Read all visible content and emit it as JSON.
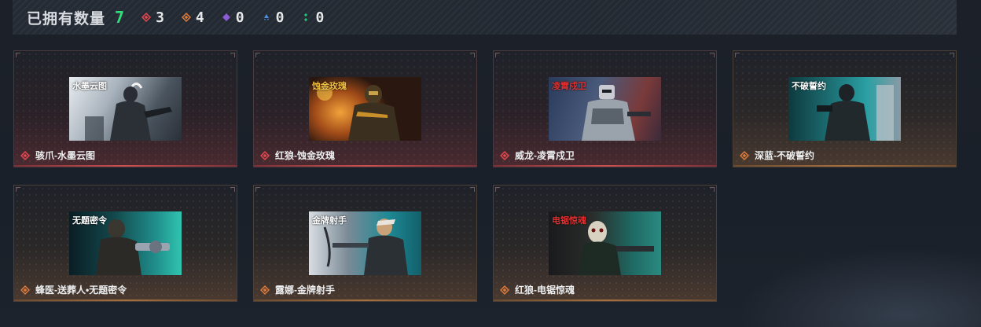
{
  "header": {
    "label": "已拥有数量",
    "total": "7",
    "stats": [
      {
        "icon": "red-diamond-icon",
        "color": "#e0474f",
        "count": "3"
      },
      {
        "icon": "orange-diamond-icon",
        "color": "#d9793b",
        "count": "4"
      },
      {
        "icon": "purple-diamond-icon",
        "color": "#8b5cd6",
        "count": "0"
      },
      {
        "icon": "blue-triangle-icon",
        "color": "#4a8fe0",
        "count": "0"
      },
      {
        "icon": "green-dots-icon",
        "color": "#25c07a",
        "count": "0"
      }
    ]
  },
  "cards": [
    {
      "name": "骇爪-水墨云图",
      "rarity": "red",
      "thumb_title": "水墨云图"
    },
    {
      "name": "红狼-蚀金玫瑰",
      "rarity": "red",
      "thumb_title": "蚀金玫瑰"
    },
    {
      "name": "威龙-凌霄戍卫",
      "rarity": "red",
      "thumb_title": "凌霄戍卫"
    },
    {
      "name": "深蓝-不破誓约",
      "rarity": "orange",
      "thumb_title": "不破誓约"
    },
    {
      "name": "蜂医-送葬人•无题密令",
      "rarity": "orange",
      "thumb_title": "无题密令"
    },
    {
      "name": "露娜-金牌射手",
      "rarity": "orange",
      "thumb_title": "金牌射手"
    },
    {
      "name": "红狼-电锯惊魂",
      "rarity": "orange",
      "thumb_title": "电锯惊魂"
    }
  ],
  "colors": {
    "red_gem": "#e0474f",
    "orange_gem": "#d9793b",
    "total_green": "#2ee07a"
  }
}
